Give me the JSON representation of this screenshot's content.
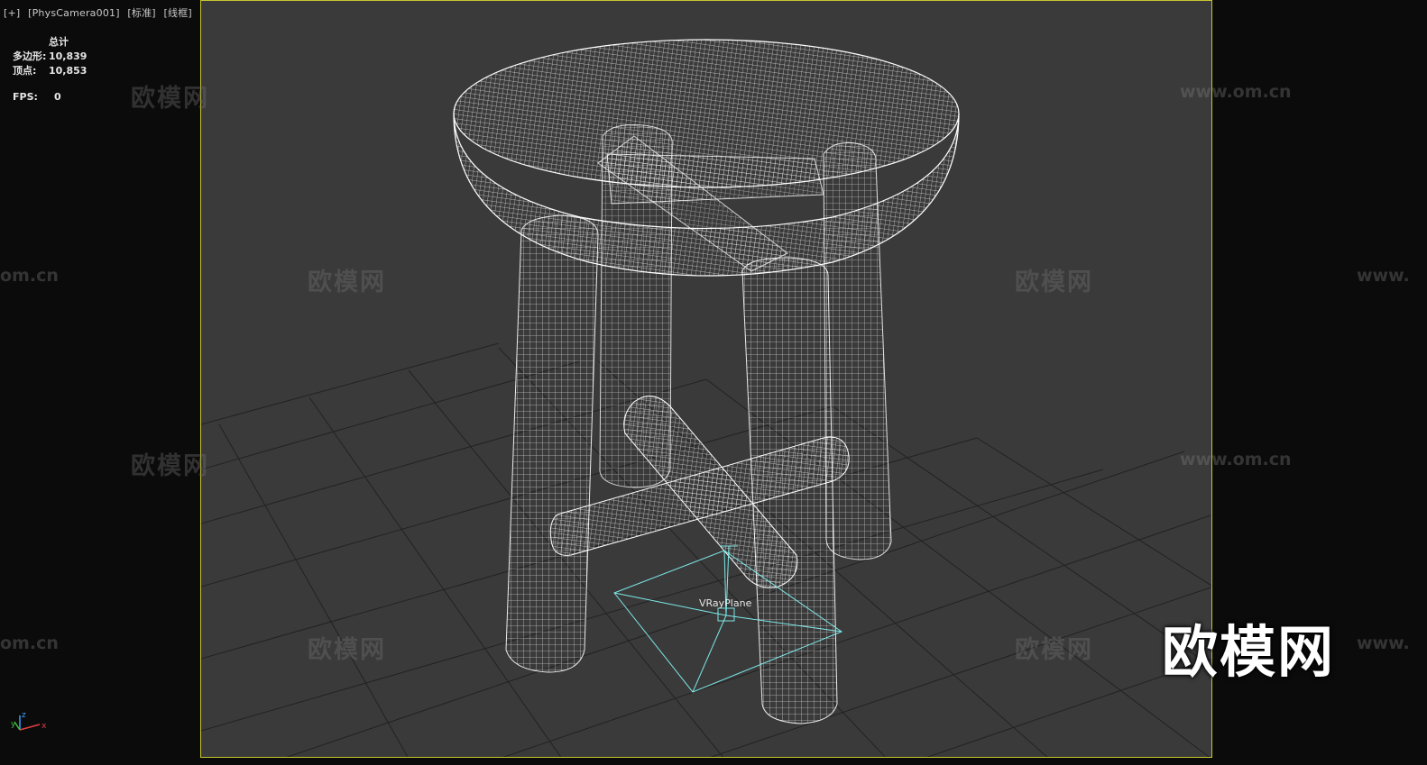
{
  "viewport": {
    "label_parts": [
      "[+]",
      "[PhysCamera001]",
      "[标准]",
      "[线框]"
    ],
    "border_color": "#c9c62e",
    "background": "#3a3a3a"
  },
  "stats": {
    "header": "总计",
    "polygons_label": "多边形:",
    "polygons_value": "10,839",
    "vertices_label": "顶点:",
    "vertices_value": "10,853",
    "fps_label": "FPS:",
    "fps_value": "0"
  },
  "scene": {
    "object_label": "VRayPlane",
    "wireframe_color": "#ffffff",
    "grid_color": "#1e1e1e",
    "plane_color": "#7ee8e8"
  },
  "gizmo": {
    "axis_x": "x",
    "axis_y": "y",
    "axis_z": "z"
  },
  "watermarks": {
    "cn": "欧模网",
    "url": "www.om.cn",
    "url_partial": "om.cn",
    "url_partial_right": "www.",
    "logo": "欧模网"
  }
}
